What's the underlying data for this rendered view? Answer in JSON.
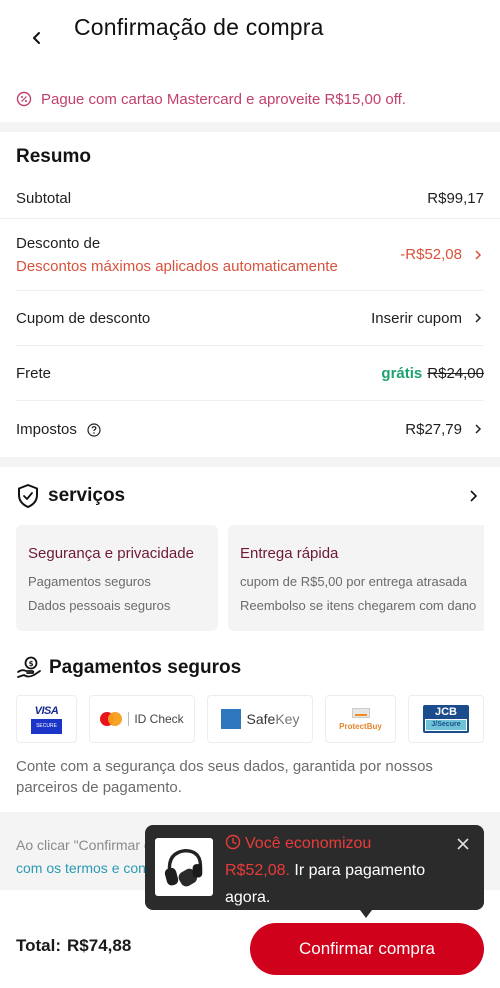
{
  "header": {
    "title": "Confirmação de compra",
    "back_icon": "chevron-left-icon"
  },
  "promo": {
    "icon": "percent-badge-icon",
    "text": "Pague com cartao Mastercard e aproveite R$15,00 off."
  },
  "summary": {
    "title": "Resumo",
    "subtotal": {
      "label": "Subtotal",
      "value": "R$99,17"
    },
    "discount": {
      "label": "Desconto de",
      "sublabel": "Descontos máximos aplicados automaticamente",
      "value": "-R$52,08"
    },
    "coupon": {
      "label": "Cupom de desconto",
      "value": "Inserir cupom"
    },
    "shipping": {
      "label": "Frete",
      "free_label": "grátis",
      "original_value": "R$24,00"
    },
    "taxes": {
      "label": "Impostos",
      "value": "R$27,79"
    }
  },
  "services": {
    "title": "serviços",
    "cards": [
      {
        "title": "Segurança e privacidade",
        "lines": [
          "Pagamentos seguros",
          "Dados pessoais seguros"
        ]
      },
      {
        "title": "Entrega rápida",
        "lines": [
          "cupom de R$5,00 por entrega atrasada",
          "Reembolso se itens chegarem com dano"
        ]
      }
    ]
  },
  "secure_payments": {
    "title": "Pagamentos seguros",
    "badges": {
      "visa": {
        "word": "VISA",
        "sub": "SECURE"
      },
      "mastercard": {
        "text": "ID Check"
      },
      "amex": {
        "text_a": "Safe",
        "text_b": "Key"
      },
      "discover": {
        "text": "ProtectBuy"
      },
      "jcb": {
        "top": "JCB",
        "bottom": "J/Secure"
      }
    },
    "description": "Conte com a segurança dos seus dados, garantida por nossos parceiros de pagamento."
  },
  "terms": {
    "line1": "Ao clicar \"Confirmar compra\", você concorda",
    "line2": "com os termos e condições"
  },
  "footer": {
    "total_label": "Total:",
    "total_value": "R$74,88",
    "confirm_label": "Confirmar compra"
  },
  "tooltip": {
    "heading": "Você economizou",
    "amount": "R$52,08.",
    "message": "Ir para pagamento agora.",
    "product_image": "headphones-image"
  },
  "colors": {
    "brand_red": "#d0021b",
    "promo_pink": "#c2416a",
    "discount_orange": "#d9523c",
    "free_green": "#1ea26f",
    "link_blue": "#2a9ab5",
    "card_title_maroon": "#6e1a35",
    "tooltip_bg": "#2b2b2b"
  }
}
